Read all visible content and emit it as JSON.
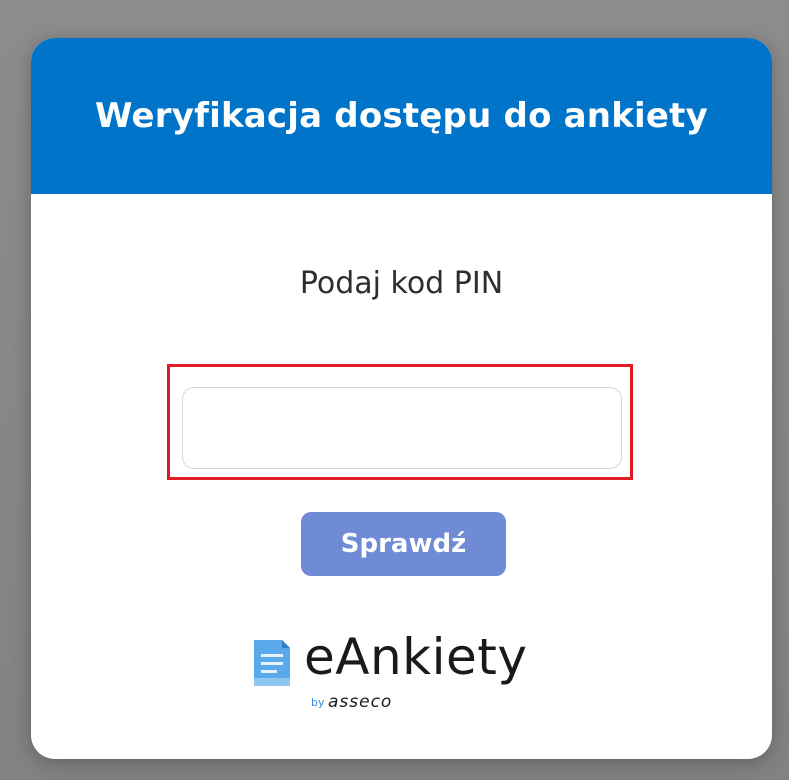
{
  "dialog": {
    "title": "Weryfikacja dostępu do ankiety",
    "header_color": "#0074c8",
    "prompt": "Podaj kod PIN",
    "pin_input": {
      "value": "",
      "placeholder": ""
    },
    "check_button_label": "Sprawdź",
    "button_color": "#6f8bd6",
    "highlight_color": "#e21b25"
  },
  "logo": {
    "icon": "document-icon",
    "name": "eAnkiety",
    "by": "by",
    "brand": "asseco"
  }
}
